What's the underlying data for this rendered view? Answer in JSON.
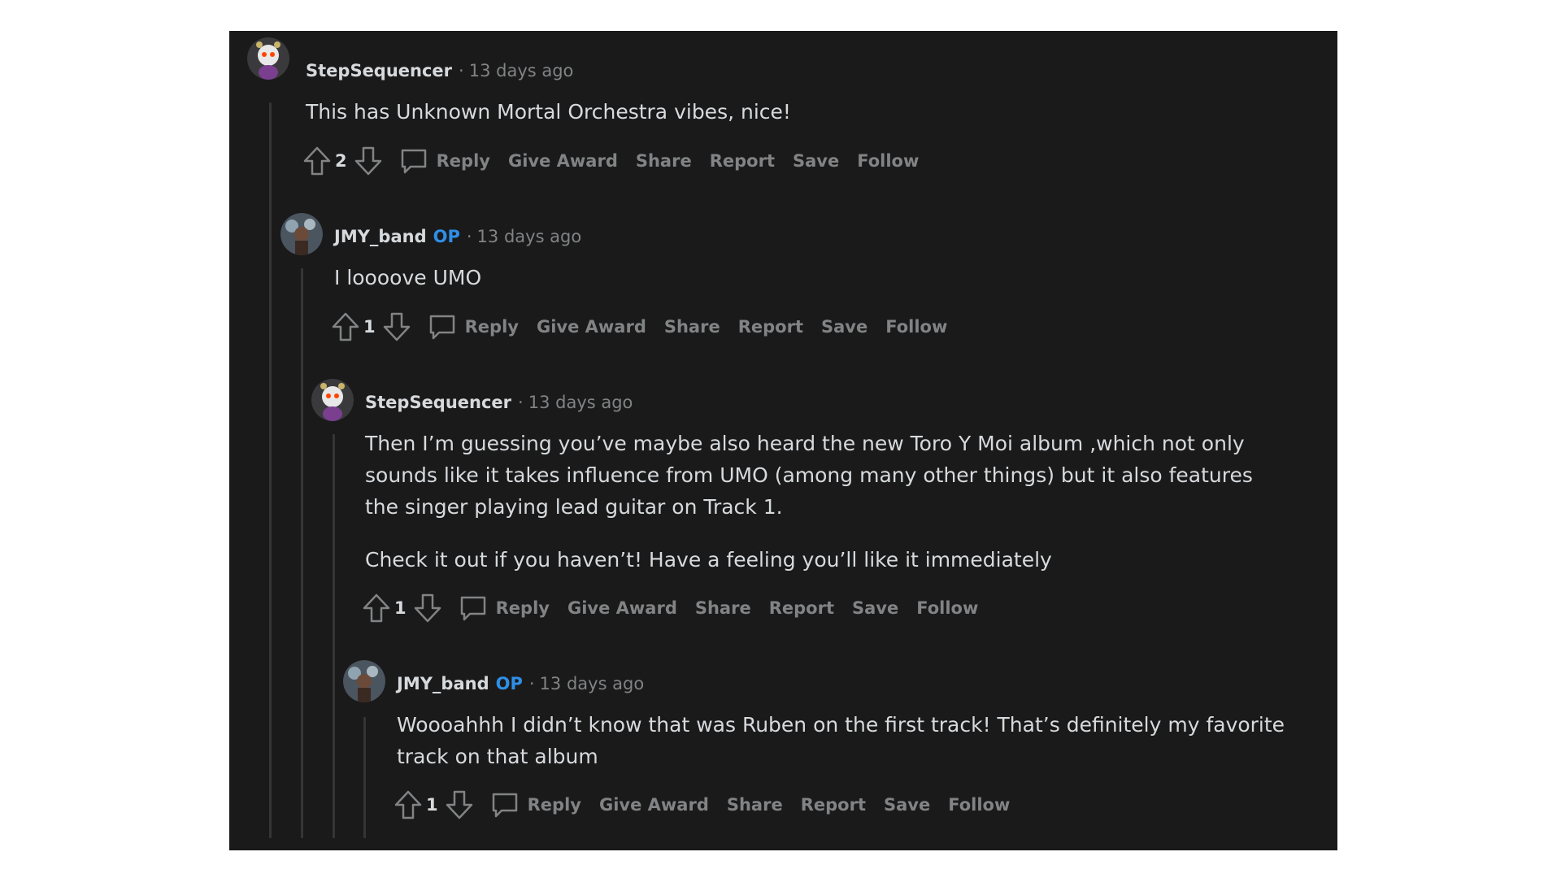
{
  "colors": {
    "background": "#1a1a1b",
    "text": "#d7dadc",
    "muted": "#818384",
    "op_badge": "#2f8fe6",
    "thread_line": "#343536"
  },
  "icons": {
    "upvote": "arrow-up-outline",
    "downvote": "arrow-down-outline",
    "reply": "speech-bubble-outline",
    "avatar": "snoo-avatar"
  },
  "action_labels": {
    "reply": "Reply",
    "give_award": "Give Award",
    "share": "Share",
    "report": "Report",
    "save": "Save",
    "follow": "Follow"
  },
  "comments": [
    {
      "author": "StepSequencer",
      "op": "",
      "separator": "·",
      "time": "13 days ago",
      "body": [
        "This has Unknown Mortal Orchestra vibes, nice!"
      ],
      "score": "2"
    },
    {
      "author": "JMY_band",
      "op": "OP",
      "separator": "·",
      "time": "13 days ago",
      "body": [
        "I loooove UMO"
      ],
      "score": "1"
    },
    {
      "author": "StepSequencer",
      "op": "",
      "separator": "·",
      "time": "13 days ago",
      "body": [
        "Then I’m guessing you’ve maybe also heard the new Toro Y Moi album ,which not only sounds like it takes influence from UMO (among many other things) but it also features the singer playing lead guitar on Track 1.",
        "Check it out if you haven’t! Have a feeling you’ll like it immediately"
      ],
      "score": "1"
    },
    {
      "author": "JMY_band",
      "op": "OP",
      "separator": "·",
      "time": "13 days ago",
      "body": [
        "Woooahhh I didn’t know that was Ruben on the first track! That’s definitely my favorite track on that album"
      ],
      "score": "1"
    }
  ]
}
